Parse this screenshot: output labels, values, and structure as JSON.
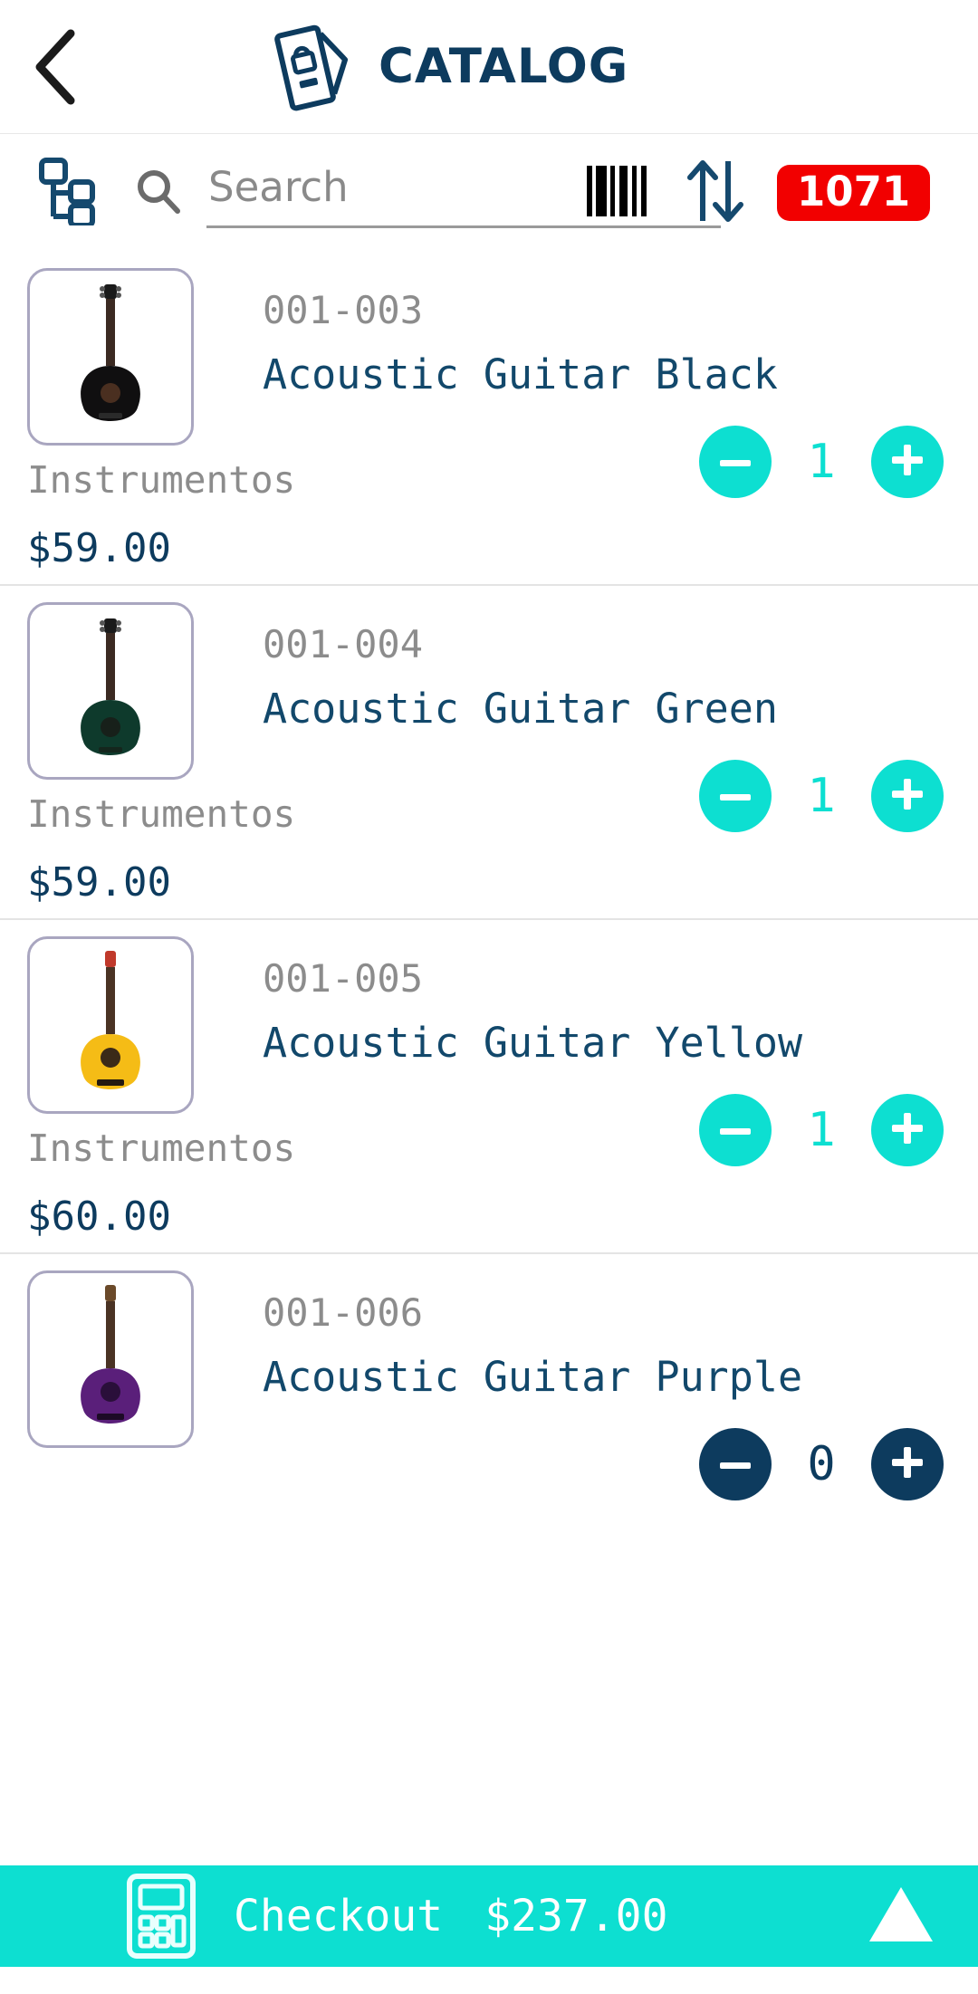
{
  "header": {
    "back_icon": "chevron-left-icon",
    "brand_icon": "tag-lock-icon",
    "title": "CATALOG"
  },
  "toolbar": {
    "tree_icon": "hierarchy-tree-icon",
    "search_icon": "search-icon",
    "search_value": "",
    "search_placeholder": "Search",
    "barcode_icon": "barcode-icon",
    "sort_icon": "sort-arrows-icon",
    "count_badge": "1071",
    "badge_color": "#f20000"
  },
  "colors": {
    "accent_cyan": "#0ddfd1",
    "navy": "#0d3b5e",
    "muted_gray": "#8c8c8c",
    "thumb_border": "#a9a6c0"
  },
  "products": [
    {
      "sku": "001-003",
      "name": "Acoustic Guitar Black",
      "category": "Instrumentos",
      "price": "$59.00",
      "qty": "1",
      "qty_state": "active",
      "minus_label": "–",
      "plus_label": "+",
      "body_color": "#100f10",
      "neck_color": "#3b2a22"
    },
    {
      "sku": "001-004",
      "name": "Acoustic Guitar Green",
      "category": "Instrumentos",
      "price": "$59.00",
      "qty": "1",
      "qty_state": "active",
      "minus_label": "–",
      "plus_label": "+",
      "body_color": "#0e3a2c",
      "neck_color": "#3b2a22"
    },
    {
      "sku": "001-005",
      "name": "Acoustic Guitar Yellow",
      "category": "Instrumentos",
      "price": "$60.00",
      "qty": "1",
      "qty_state": "active",
      "minus_label": "–",
      "plus_label": "+",
      "body_color": "#f5bc16",
      "neck_color": "#4a3324"
    },
    {
      "sku": "001-006",
      "name": "Acoustic Guitar Purple",
      "category": "",
      "price": "",
      "qty": "0",
      "qty_state": "zero",
      "minus_label": "–",
      "plus_label": "+",
      "body_color": "#5a1f7a",
      "neck_color": "#4a3324"
    }
  ],
  "checkout": {
    "calculator_icon": "calculator-icon",
    "label": "Checkout",
    "total": "$237.00",
    "expand_icon": "triangle-up-icon"
  }
}
